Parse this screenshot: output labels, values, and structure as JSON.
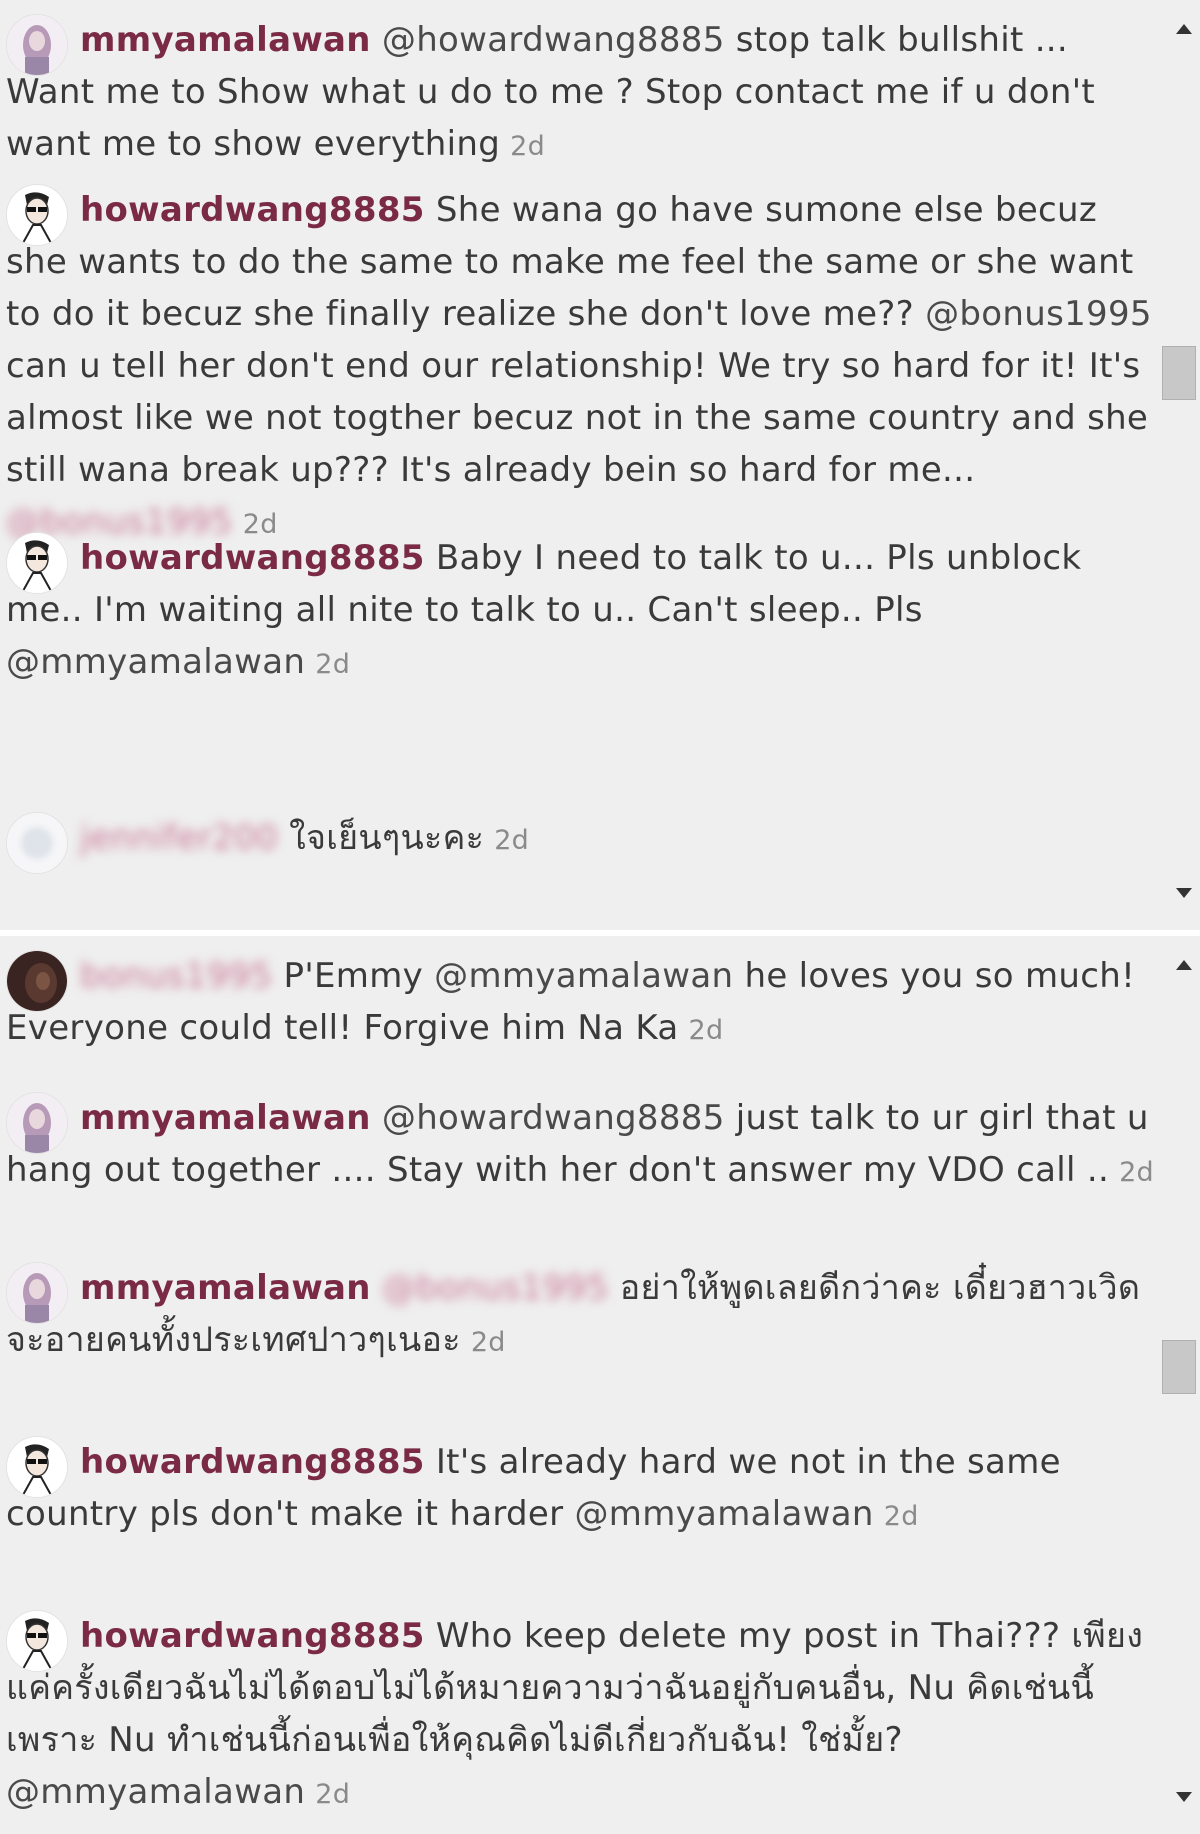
{
  "colors": {
    "username": "#7a2a45",
    "timestamp": "#8a8a8a",
    "text": "#3a3a3a",
    "background": "#efefef"
  },
  "panels": [
    {
      "comments": [
        {
          "avatar": "avatar-mmyamalawan",
          "user": "mmyamalawan",
          "parts": [
            {
              "t": "mention",
              "v": "@howardwang8885"
            },
            {
              "t": "text",
              "v": " stop talk bullshit ... Want me to Show what u do to me ? Stop contact me if u don't want me to show everything"
            }
          ],
          "time": "2d"
        },
        {
          "avatar": "avatar-howardwang8885",
          "user": "howardwang8885",
          "parts": [
            {
              "t": "text",
              "v": "She wana go have sumone else becuz she wants to do the same to make me feel the same or she want to do it becuz she finally realize she don't love me?? "
            },
            {
              "t": "mention",
              "v": "@bonus1995"
            },
            {
              "t": "text",
              "v": " can u tell her don't end our relationship! We try so hard for it! It's almost like we not togther becuz not in the same country and she still wana break up??? It's already bein so hard for me... "
            },
            {
              "t": "blurred",
              "v": "@bonus1995"
            }
          ],
          "time": "2d"
        },
        {
          "avatar": "avatar-howardwang8885",
          "user": "howardwang8885",
          "parts": [
            {
              "t": "text",
              "v": "Baby I need to talk to u... Pls unblock me.. I'm waiting all nite to talk to u.. Can't sleep.. Pls "
            },
            {
              "t": "mention",
              "v": "@mmyamalawan"
            }
          ],
          "time": "2d"
        },
        {
          "avatar": "avatar-blurred",
          "user": "jennifer200",
          "userBlurred": true,
          "parts": [
            {
              "t": "text",
              "v": "ใจเย็นๆนะคะ"
            }
          ],
          "time": "2d"
        }
      ]
    },
    {
      "comments": [
        {
          "avatar": "avatar-dark",
          "user": "bonus1995",
          "userBlurred": true,
          "parts": [
            {
              "t": "text",
              "v": "P'Emmy "
            },
            {
              "t": "mention",
              "v": "@mmyamalawan"
            },
            {
              "t": "text",
              "v": " he loves you so much! Everyone could tell! Forgive him Na Ka"
            }
          ],
          "time": "2d"
        },
        {
          "avatar": "avatar-mmyamalawan",
          "user": "mmyamalawan",
          "parts": [
            {
              "t": "mention",
              "v": "@howardwang8885"
            },
            {
              "t": "text",
              "v": " just talk to ur girl that u hang out together .... Stay with her don't answer my VDO call .."
            }
          ],
          "time": "2d"
        },
        {
          "avatar": "avatar-mmyamalawan",
          "user": "mmyamalawan",
          "parts": [
            {
              "t": "blurred",
              "v": "@bonus1995"
            },
            {
              "t": "text",
              "v": " อย่าให้พูดเลยดีกว่าคะ เดี๋ยวฮาวเวิดจะอายคนทั้งประเทศปาวๆเนอะ"
            }
          ],
          "time": "2d"
        },
        {
          "avatar": "avatar-howardwang8885",
          "user": "howardwang8885",
          "parts": [
            {
              "t": "text",
              "v": "It's already hard we not in the same country pls don't make it harder "
            },
            {
              "t": "mention",
              "v": "@mmyamalawan"
            }
          ],
          "time": "2d"
        },
        {
          "avatar": "avatar-howardwang8885",
          "user": "howardwang8885",
          "parts": [
            {
              "t": "text",
              "v": "Who keep delete my post in Thai??? เพียงแค่ครั้งเดียวฉันไม่ได้ตอบไม่ได้หมายความว่าฉันอยู่กับคนอื่น, Nu คิดเช่นนี้เพราะ Nu ทำเช่นนี้ก่อนเพื่อให้คุณคิดไม่ดีเกี่ยวกับฉัน! ใช่มั้ย? "
            },
            {
              "t": "mention",
              "v": "@mmyamalawan"
            }
          ],
          "time": "2d"
        }
      ]
    }
  ]
}
